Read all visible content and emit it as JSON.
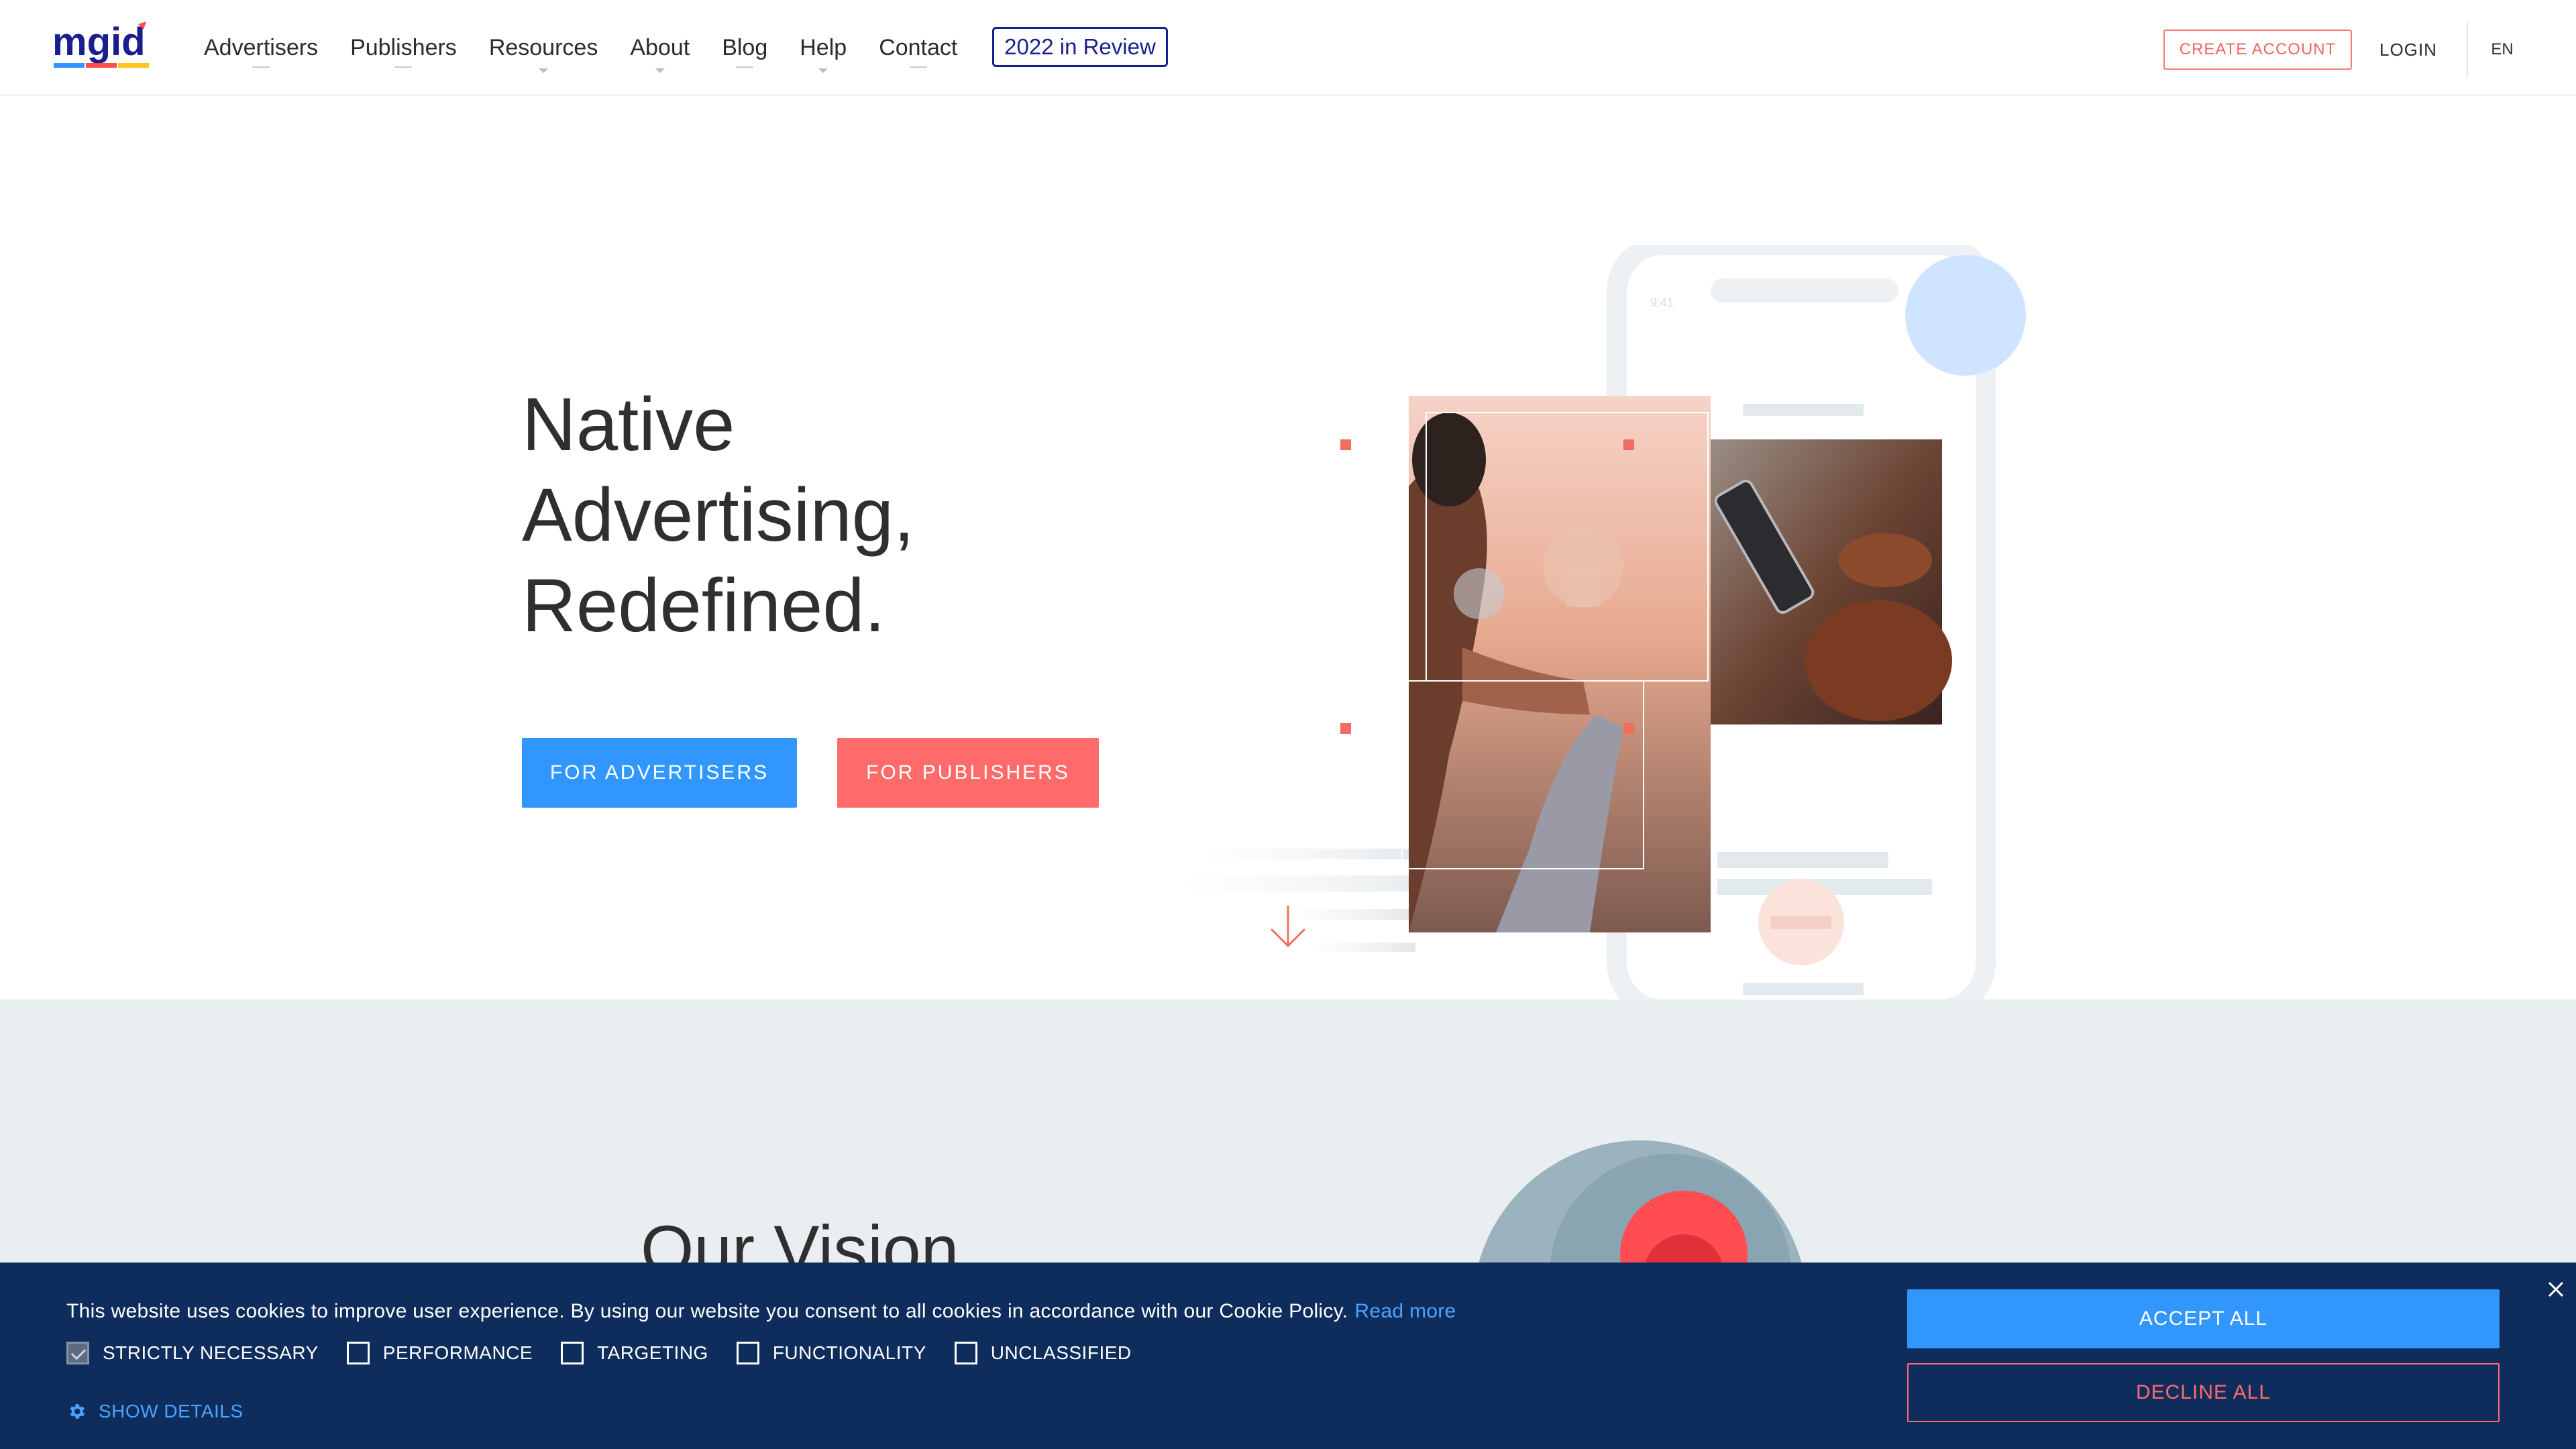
{
  "header": {
    "logo_text": "mgid",
    "nav": [
      {
        "label": "Advertisers",
        "marker": "underline"
      },
      {
        "label": "Publishers",
        "marker": "underline"
      },
      {
        "label": "Resources",
        "marker": "caret"
      },
      {
        "label": "About",
        "marker": "caret"
      },
      {
        "label": "Blog",
        "marker": "underline"
      },
      {
        "label": "Help",
        "marker": "caret"
      },
      {
        "label": "Contact",
        "marker": "underline"
      }
    ],
    "review_label": "2022 in Review",
    "create_account_label": "CREATE ACCOUNT",
    "login_label": "LOGIN",
    "language_label": "EN"
  },
  "hero": {
    "title_lines": [
      "Native",
      "Advertising,",
      "Redefined."
    ],
    "for_advertisers_label": "FOR ADVERTISERS",
    "for_publishers_label": "FOR PUBLISHERS",
    "phone_time": "9:41"
  },
  "vision": {
    "title": "Our Vision"
  },
  "cookie_banner": {
    "message": "This website uses cookies to improve user experience. By using our website you consent to all cookies in accordance with our Cookie Policy.",
    "read_more_label": "Read more",
    "options": [
      {
        "label": "STRICTLY NECESSARY",
        "checked": true
      },
      {
        "label": "PERFORMANCE",
        "checked": false
      },
      {
        "label": "TARGETING",
        "checked": false
      },
      {
        "label": "FUNCTIONALITY",
        "checked": false
      },
      {
        "label": "UNCLASSIFIED",
        "checked": false
      }
    ],
    "show_details_label": "SHOW DETAILS",
    "accept_label": "ACCEPT ALL",
    "decline_label": "DECLINE ALL"
  },
  "colors": {
    "brand_blue": "#3197ff",
    "brand_coral": "#ff6b6b",
    "review_blue": "#1a1f8f",
    "banner_navy": "#0f2d5c",
    "link_blue": "#4aa3ff"
  }
}
